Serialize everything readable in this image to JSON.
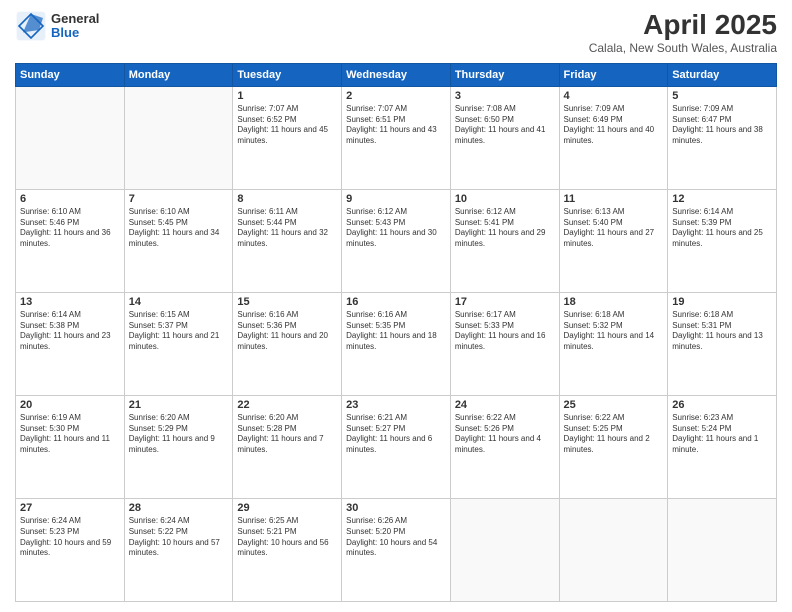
{
  "header": {
    "logo": {
      "general": "General",
      "blue": "Blue"
    },
    "title": "April 2025",
    "location": "Calala, New South Wales, Australia"
  },
  "calendar": {
    "days": [
      "Sunday",
      "Monday",
      "Tuesday",
      "Wednesday",
      "Thursday",
      "Friday",
      "Saturday"
    ],
    "weeks": [
      [
        {
          "day": "",
          "info": ""
        },
        {
          "day": "",
          "info": ""
        },
        {
          "day": "1",
          "info": "Sunrise: 7:07 AM\nSunset: 6:52 PM\nDaylight: 11 hours and 45 minutes."
        },
        {
          "day": "2",
          "info": "Sunrise: 7:07 AM\nSunset: 6:51 PM\nDaylight: 11 hours and 43 minutes."
        },
        {
          "day": "3",
          "info": "Sunrise: 7:08 AM\nSunset: 6:50 PM\nDaylight: 11 hours and 41 minutes."
        },
        {
          "day": "4",
          "info": "Sunrise: 7:09 AM\nSunset: 6:49 PM\nDaylight: 11 hours and 40 minutes."
        },
        {
          "day": "5",
          "info": "Sunrise: 7:09 AM\nSunset: 6:47 PM\nDaylight: 11 hours and 38 minutes."
        }
      ],
      [
        {
          "day": "6",
          "info": "Sunrise: 6:10 AM\nSunset: 5:46 PM\nDaylight: 11 hours and 36 minutes."
        },
        {
          "day": "7",
          "info": "Sunrise: 6:10 AM\nSunset: 5:45 PM\nDaylight: 11 hours and 34 minutes."
        },
        {
          "day": "8",
          "info": "Sunrise: 6:11 AM\nSunset: 5:44 PM\nDaylight: 11 hours and 32 minutes."
        },
        {
          "day": "9",
          "info": "Sunrise: 6:12 AM\nSunset: 5:43 PM\nDaylight: 11 hours and 30 minutes."
        },
        {
          "day": "10",
          "info": "Sunrise: 6:12 AM\nSunset: 5:41 PM\nDaylight: 11 hours and 29 minutes."
        },
        {
          "day": "11",
          "info": "Sunrise: 6:13 AM\nSunset: 5:40 PM\nDaylight: 11 hours and 27 minutes."
        },
        {
          "day": "12",
          "info": "Sunrise: 6:14 AM\nSunset: 5:39 PM\nDaylight: 11 hours and 25 minutes."
        }
      ],
      [
        {
          "day": "13",
          "info": "Sunrise: 6:14 AM\nSunset: 5:38 PM\nDaylight: 11 hours and 23 minutes."
        },
        {
          "day": "14",
          "info": "Sunrise: 6:15 AM\nSunset: 5:37 PM\nDaylight: 11 hours and 21 minutes."
        },
        {
          "day": "15",
          "info": "Sunrise: 6:16 AM\nSunset: 5:36 PM\nDaylight: 11 hours and 20 minutes."
        },
        {
          "day": "16",
          "info": "Sunrise: 6:16 AM\nSunset: 5:35 PM\nDaylight: 11 hours and 18 minutes."
        },
        {
          "day": "17",
          "info": "Sunrise: 6:17 AM\nSunset: 5:33 PM\nDaylight: 11 hours and 16 minutes."
        },
        {
          "day": "18",
          "info": "Sunrise: 6:18 AM\nSunset: 5:32 PM\nDaylight: 11 hours and 14 minutes."
        },
        {
          "day": "19",
          "info": "Sunrise: 6:18 AM\nSunset: 5:31 PM\nDaylight: 11 hours and 13 minutes."
        }
      ],
      [
        {
          "day": "20",
          "info": "Sunrise: 6:19 AM\nSunset: 5:30 PM\nDaylight: 11 hours and 11 minutes."
        },
        {
          "day": "21",
          "info": "Sunrise: 6:20 AM\nSunset: 5:29 PM\nDaylight: 11 hours and 9 minutes."
        },
        {
          "day": "22",
          "info": "Sunrise: 6:20 AM\nSunset: 5:28 PM\nDaylight: 11 hours and 7 minutes."
        },
        {
          "day": "23",
          "info": "Sunrise: 6:21 AM\nSunset: 5:27 PM\nDaylight: 11 hours and 6 minutes."
        },
        {
          "day": "24",
          "info": "Sunrise: 6:22 AM\nSunset: 5:26 PM\nDaylight: 11 hours and 4 minutes."
        },
        {
          "day": "25",
          "info": "Sunrise: 6:22 AM\nSunset: 5:25 PM\nDaylight: 11 hours and 2 minutes."
        },
        {
          "day": "26",
          "info": "Sunrise: 6:23 AM\nSunset: 5:24 PM\nDaylight: 11 hours and 1 minute."
        }
      ],
      [
        {
          "day": "27",
          "info": "Sunrise: 6:24 AM\nSunset: 5:23 PM\nDaylight: 10 hours and 59 minutes."
        },
        {
          "day": "28",
          "info": "Sunrise: 6:24 AM\nSunset: 5:22 PM\nDaylight: 10 hours and 57 minutes."
        },
        {
          "day": "29",
          "info": "Sunrise: 6:25 AM\nSunset: 5:21 PM\nDaylight: 10 hours and 56 minutes."
        },
        {
          "day": "30",
          "info": "Sunrise: 6:26 AM\nSunset: 5:20 PM\nDaylight: 10 hours and 54 minutes."
        },
        {
          "day": "",
          "info": ""
        },
        {
          "day": "",
          "info": ""
        },
        {
          "day": "",
          "info": ""
        }
      ]
    ]
  }
}
